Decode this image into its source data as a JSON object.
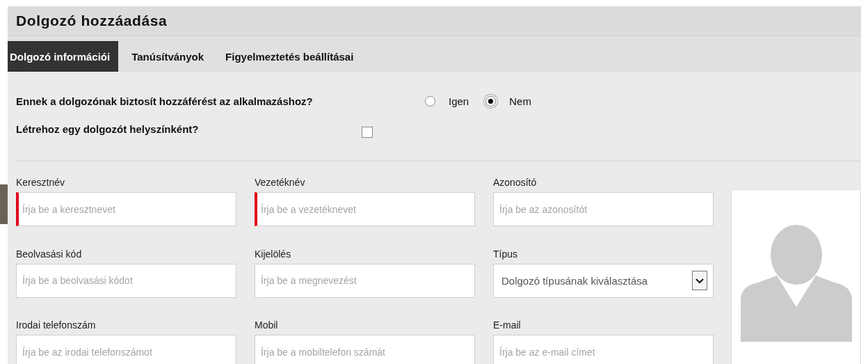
{
  "title": "Dolgozó hozzáadása",
  "tabs": [
    {
      "label": "Dolgozó információi",
      "selected": true
    },
    {
      "label": "Tanúsítványok",
      "selected": false
    },
    {
      "label": "Figyelmeztetés beállításai",
      "selected": false
    }
  ],
  "access_question": {
    "label": "Ennek a dolgozónak biztosít hozzáférést az alkalmazáshoz?",
    "options": [
      {
        "label": "Igen",
        "selected": false
      },
      {
        "label": "Nem",
        "selected": true
      }
    ]
  },
  "location_question": {
    "label": "Létrehoz egy dolgozót helyszínként?",
    "checked": false
  },
  "fields": [
    {
      "kind": "text",
      "label": "Keresztnév",
      "placeholder": "Írja be a keresztnevet",
      "required": true
    },
    {
      "kind": "text",
      "label": "Vezetéknév",
      "placeholder": "Írja be a vezetéknevet",
      "required": true
    },
    {
      "kind": "text",
      "label": "Azonosító",
      "placeholder": "Írja be az azonosítót",
      "required": false
    },
    {
      "kind": "text",
      "label": "Beolvasási kód",
      "placeholder": "Írja be a beolvasási kódot",
      "required": false
    },
    {
      "kind": "text",
      "label": "Kijelölés",
      "placeholder": "Írja be a megnevezést",
      "required": false
    },
    {
      "kind": "select",
      "label": "Típus",
      "value": "Dolgozó típusának kiválasztása",
      "required": false
    },
    {
      "kind": "text",
      "label": "Irodai telefonszám",
      "placeholder": "Írja be az irodai telefonszámot",
      "required": false
    },
    {
      "kind": "text",
      "label": "Mobil",
      "placeholder": "Írja be a mobiltelefon számát",
      "required": false
    },
    {
      "kind": "text",
      "label": "E-mail",
      "placeholder": "Írja be az e-mail címet",
      "required": false
    }
  ]
}
